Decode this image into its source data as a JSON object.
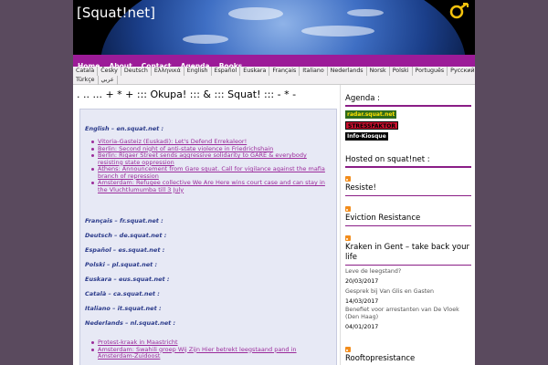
{
  "site": {
    "title": "[Squat!net]"
  },
  "nav": [
    "Home",
    "About",
    "Contact",
    "Agenda",
    "Books"
  ],
  "languages": {
    "row1": [
      "Català",
      "Česky",
      "Deutsch",
      "Ελληνικά",
      "English",
      "Español",
      "Euskara",
      "Français",
      "Italiano",
      "Nederlands",
      "Norsk",
      "Polski",
      "Português",
      "Русский"
    ],
    "row2": [
      "Türkçe",
      "عربي"
    ]
  },
  "main": {
    "heading": ". .. ... + * + ::: Okupa! ::: & ::: Squat! ::: - * -",
    "sections": [
      {
        "label": "English – en.squat.net :",
        "links": [
          "Vitoria-Gasteiz (Euskadi): Let's Defend Errekaleor!",
          "Berlin: Second night of anti-state violence in Friedrichshain",
          "Berlin: Rigaer Street sends aggressive solidarity to GARE & everybody resisting state oppression",
          "Athens: Announcement from Gare squat. Call for vigilance against the mafia branch of repression",
          "Amsterdam: Refugee collective We Are Here wins court case and can stay in the Vluchtlumumba till 3 July"
        ]
      },
      {
        "label": "Français – fr.squat.net :",
        "links": []
      },
      {
        "label": "Deutsch – de.squat.net :",
        "links": []
      },
      {
        "label": "Español – es.squat.net :",
        "links": []
      },
      {
        "label": "Polski – pl.squat.net :",
        "links": []
      },
      {
        "label": "Euskara – eus.squat.net :",
        "links": []
      },
      {
        "label": "Català – ca.squat.net :",
        "links": []
      },
      {
        "label": "Italiano – it.squat.net :",
        "links": []
      },
      {
        "label": "Nederlands – nl.squat.net :",
        "links": [
          "Protest-kraak in Maastricht",
          "Amsterdam: Swahili groep Wij Zijn Hier betrekt leegstaand pand in Amsterdam-Zuidoost"
        ]
      }
    ]
  },
  "sidebar": {
    "agenda_title": "Agenda :",
    "agenda_badges": [
      "radar.squat.net",
      "STRESSFAKTOR",
      "Info-Kiosque"
    ],
    "hosted_title": "Hosted on squat!net :",
    "feeds": [
      {
        "name": "Resiste!",
        "events": []
      },
      {
        "name": "Eviction Resistance",
        "events": []
      },
      {
        "name": "Kraken in Gent – take back your life",
        "events": [
          {
            "title": "Leve de leegstand?",
            "date": "20/03/2017"
          },
          {
            "title": "Gesprek bij Van Glis en Gasten",
            "date": "14/03/2017"
          },
          {
            "title": "Benefiet voor arrestanten van De Vloek (Den Haag)",
            "date": "04/01/2017"
          }
        ]
      },
      {
        "name": "Rooftopresistance",
        "events": []
      }
    ]
  },
  "colors": {
    "nav_bg": "#9c1b98",
    "link": "#9b2b9b",
    "section": "#2a3a8a",
    "outer_bg": "#5a4a5e"
  }
}
